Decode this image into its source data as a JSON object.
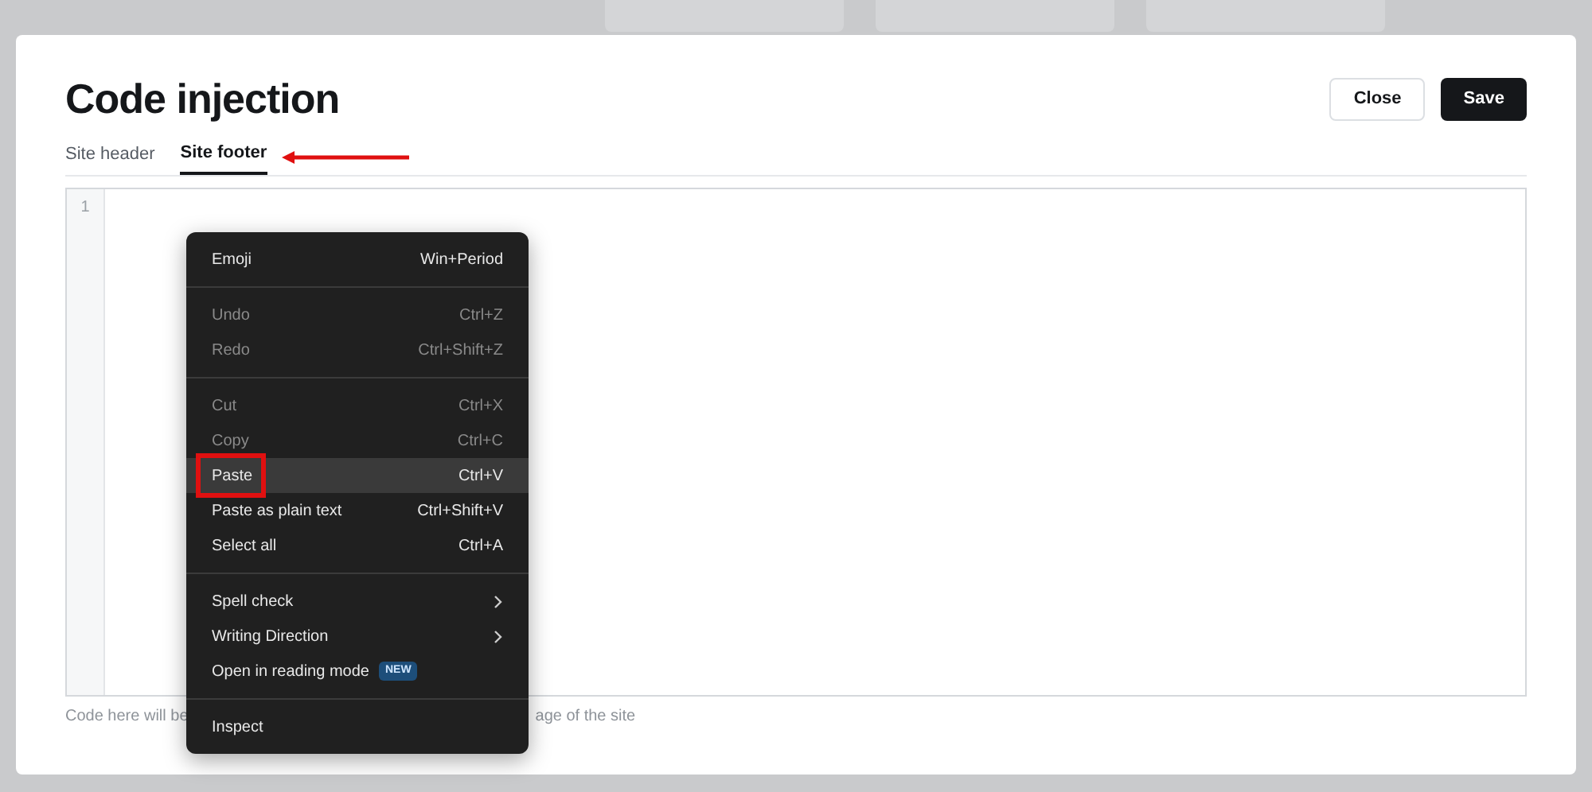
{
  "dialog": {
    "title": "Code injection",
    "buttons": [
      {
        "label": "Close",
        "kind": "secondary"
      },
      {
        "label": "Save",
        "kind": "primary"
      }
    ]
  },
  "tabs": [
    {
      "label": "Site header",
      "selected": false
    },
    {
      "label": "Site footer",
      "selected": true
    }
  ],
  "editor": {
    "line_numbers": [
      "1"
    ]
  },
  "hint": [
    "Code here will be",
    "age of the site"
  ],
  "context_menu": {
    "groups": [
      [
        {
          "label": "Emoji",
          "shortcut": "Win+Period",
          "disabled": false,
          "selected": false
        }
      ],
      [
        {
          "label": "Undo",
          "shortcut": "Ctrl+Z",
          "disabled": true,
          "selected": false
        },
        {
          "label": "Redo",
          "shortcut": "Ctrl+Shift+Z",
          "disabled": true,
          "selected": false
        }
      ],
      [
        {
          "label": "Cut",
          "shortcut": "Ctrl+X",
          "disabled": true,
          "selected": false
        },
        {
          "label": "Copy",
          "shortcut": "Ctrl+C",
          "disabled": true,
          "selected": false
        },
        {
          "label": "Paste",
          "shortcut": "Ctrl+V",
          "disabled": false,
          "selected": true
        },
        {
          "label": "Paste as plain text",
          "shortcut": "Ctrl+Shift+V",
          "disabled": false,
          "selected": false
        },
        {
          "label": "Select all",
          "shortcut": "Ctrl+A",
          "disabled": false,
          "selected": false
        }
      ],
      [
        {
          "label": "Spell check",
          "kind": "submenu",
          "disabled": false,
          "selected": false
        },
        {
          "label": "Writing Direction",
          "kind": "submenu",
          "disabled": false,
          "selected": false
        },
        {
          "label": "Open in reading mode",
          "kind": "badge",
          "badge": "NEW",
          "disabled": false,
          "selected": false
        }
      ],
      [
        {
          "label": "Inspect",
          "disabled": false,
          "selected": false
        }
      ]
    ]
  }
}
